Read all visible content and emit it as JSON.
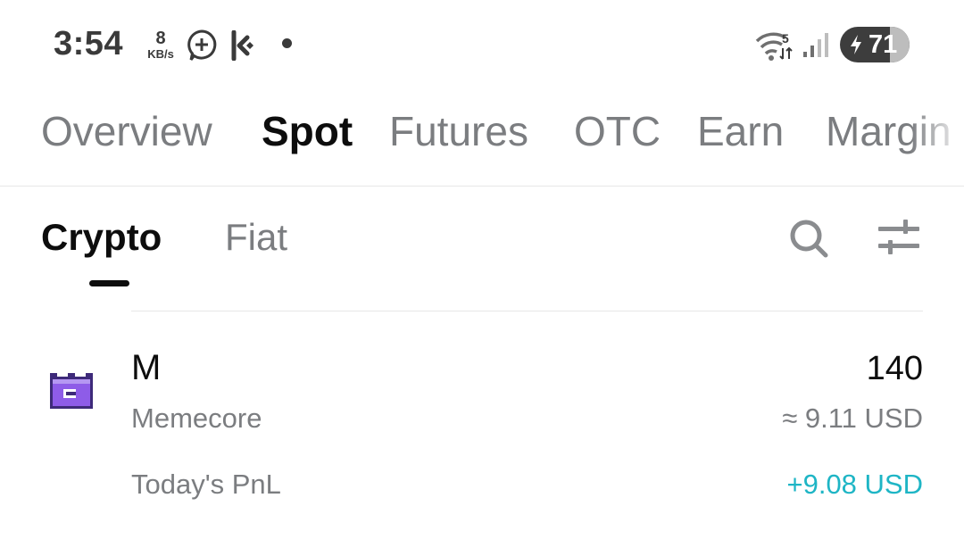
{
  "status_bar": {
    "time": "3:54",
    "net_speed_value": "8",
    "net_speed_unit": "KB/s",
    "wifi_badge": "5",
    "battery_level": "71",
    "icons": [
      "add-chat-icon",
      "kucoin-icon",
      "dot-icon",
      "wifi-icon",
      "signal-icon",
      "battery-charging-icon"
    ]
  },
  "main_tabs": [
    {
      "label": "Overview",
      "active": false
    },
    {
      "label": "Spot",
      "active": true
    },
    {
      "label": "Futures",
      "active": false
    },
    {
      "label": "OTC",
      "active": false
    },
    {
      "label": "Earn",
      "active": false
    },
    {
      "label": "Margin",
      "active": false
    }
  ],
  "sub_tabs": [
    {
      "label": "Crypto",
      "active": true
    },
    {
      "label": "Fiat",
      "active": false
    }
  ],
  "toolbar_icons": [
    "search-icon",
    "filter-sliders-icon"
  ],
  "assets": [
    {
      "symbol": "M",
      "name": "Memecore",
      "amount": "140",
      "value": "≈ 9.11 USD",
      "pnl_label": "Today's PnL",
      "pnl_value": "+9.08 USD",
      "icon": "memecore-logo-icon"
    }
  ],
  "colors": {
    "text_primary": "#0d0d0d",
    "text_secondary": "#7b7d80",
    "pnl_positive": "#1eb5c5",
    "logo_purple": "#8e5ce8"
  }
}
